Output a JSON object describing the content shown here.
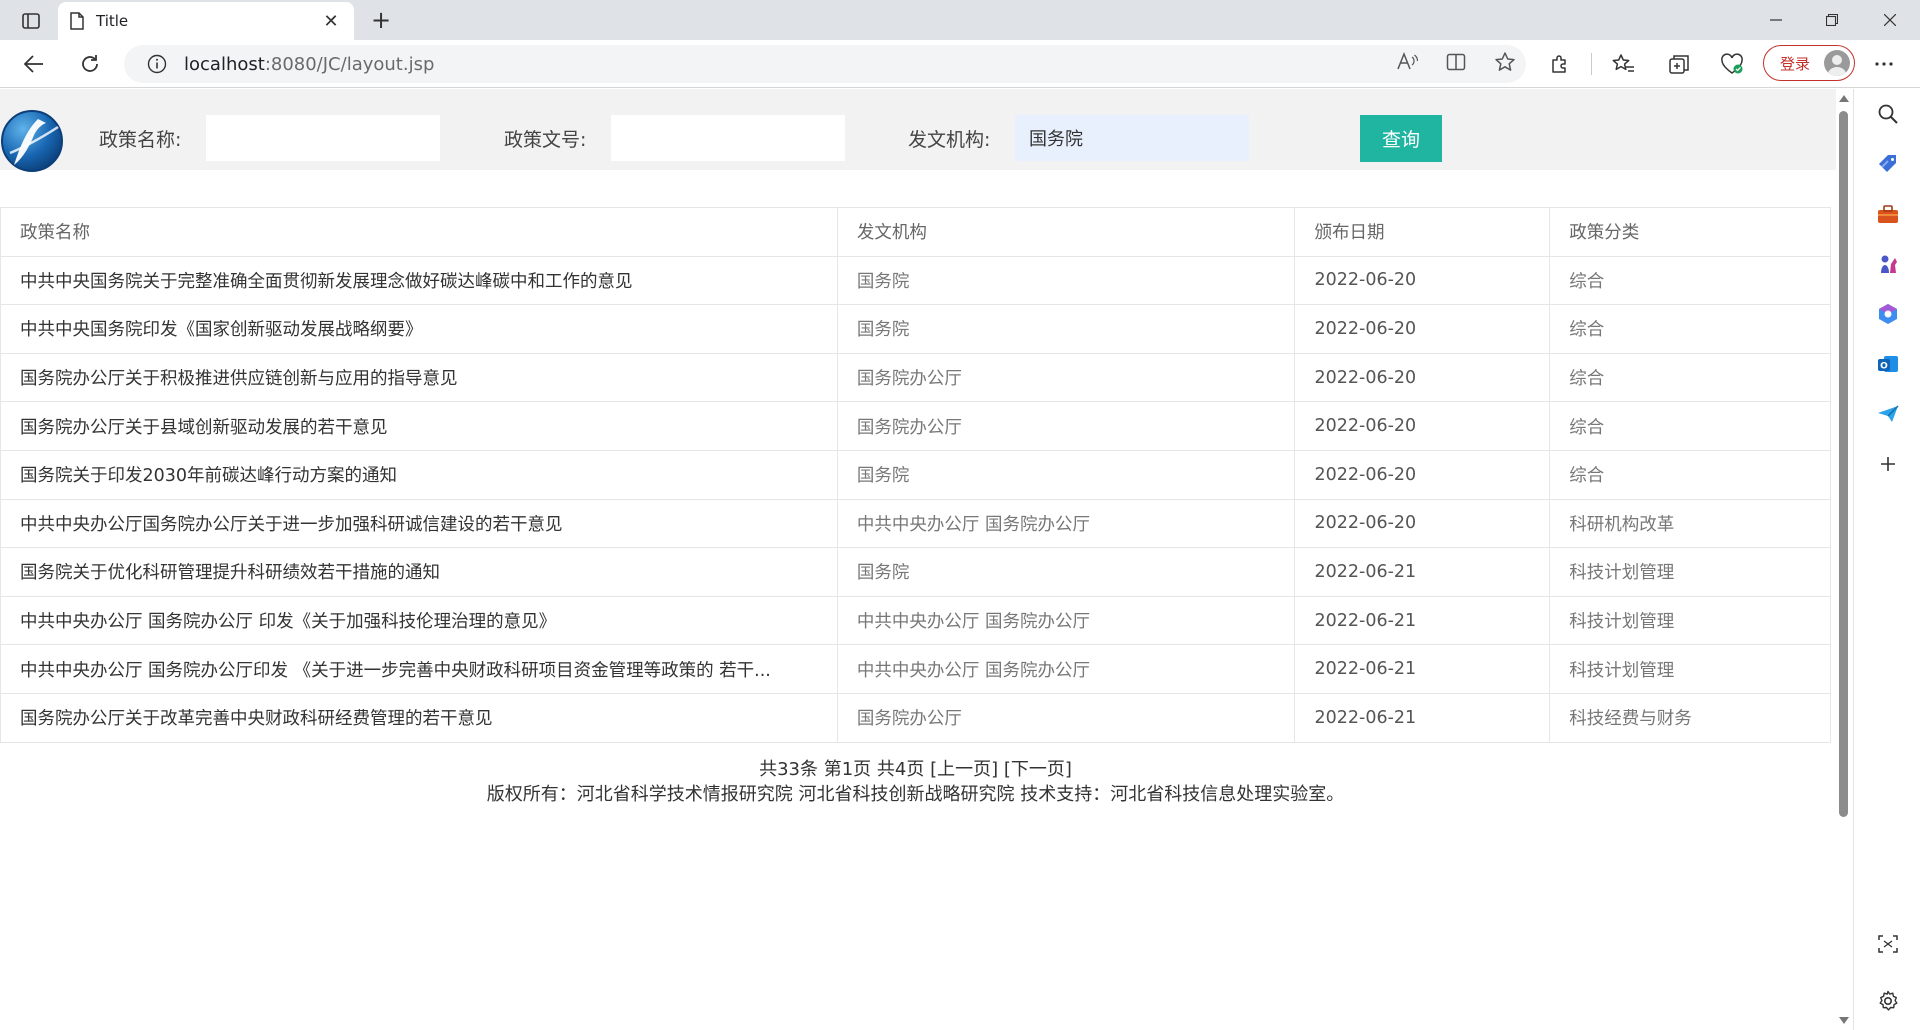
{
  "browser": {
    "tab_title": "Title",
    "url_host": "localhost",
    "url_rest": ":8080/JC/layout.jsp",
    "login_label": "登录"
  },
  "search": {
    "name_label": "政策名称:",
    "name_value": "",
    "number_label": "政策文号:",
    "number_value": "",
    "org_label": "发文机构:",
    "org_value": "国务院",
    "query_label": "查询"
  },
  "table": {
    "headers": [
      "政策名称",
      "发文机构",
      "颁布日期",
      "政策分类"
    ],
    "rows": [
      {
        "name": "中共中央国务院关于完整准确全面贯彻新发展理念做好碳达峰碳中和工作的意见",
        "org": "国务院",
        "date": "2022-06-20",
        "category": "综合"
      },
      {
        "name": "中共中央国务院印发《国家创新驱动发展战略纲要》",
        "org": "国务院",
        "date": "2022-06-20",
        "category": "综合"
      },
      {
        "name": "国务院办公厅关于积极推进供应链创新与应用的指导意见",
        "org": "国务院办公厅",
        "date": "2022-06-20",
        "category": "综合"
      },
      {
        "name": "国务院办公厅关于县域创新驱动发展的若干意见",
        "org": "国务院办公厅",
        "date": "2022-06-20",
        "category": "综合"
      },
      {
        "name": "国务院关于印发2030年前碳达峰行动方案的通知",
        "org": "国务院",
        "date": "2022-06-20",
        "category": "综合"
      },
      {
        "name": "中共中央办公厅国务院办公厅关于进一步加强科研诚信建设的若干意见",
        "org": "中共中央办公厅 国务院办公厅",
        "date": "2022-06-20",
        "category": "科研机构改革"
      },
      {
        "name": "国务院关于优化科研管理提升科研绩效若干措施的通知",
        "org": "国务院",
        "date": "2022-06-21",
        "category": "科技计划管理"
      },
      {
        "name": "中共中央办公厅 国务院办公厅 印发《关于加强科技伦理治理的意见》",
        "org": "中共中央办公厅 国务院办公厅",
        "date": "2022-06-21",
        "category": "科技计划管理"
      },
      {
        "name": "中共中央办公厅 国务院办公厅印发 《关于进一步完善中央财政科研项目资金管理等政策的 若干...",
        "org": "中共中央办公厅 国务院办公厅",
        "date": "2022-06-21",
        "category": "科技计划管理"
      },
      {
        "name": "国务院办公厅关于改革完善中央财政科研经费管理的若干意见",
        "org": "国务院办公厅",
        "date": "2022-06-21",
        "category": "科技经费与财务"
      }
    ]
  },
  "pager": "共33条 第1页 共4页 [上一页] [下一页]",
  "copyright": "版权所有：河北省科学技术情报研究院 河北省科技创新战略研究院 技术支持：河北省科技信息处理实验室。",
  "icons": {
    "sidebar": [
      "search-icon",
      "tag-icon",
      "toolbox-icon",
      "chess-icon",
      "copilot-icon",
      "outlook-icon",
      "send-icon",
      "add-icon"
    ],
    "bottom": [
      "screenshot-icon",
      "settings-icon"
    ]
  },
  "colors": {
    "query_button": "#1fb5a0",
    "login_border": "#c4312c",
    "search_bar_bg": "#f2f2f2",
    "autofill_bg": "#e8f0fe"
  }
}
